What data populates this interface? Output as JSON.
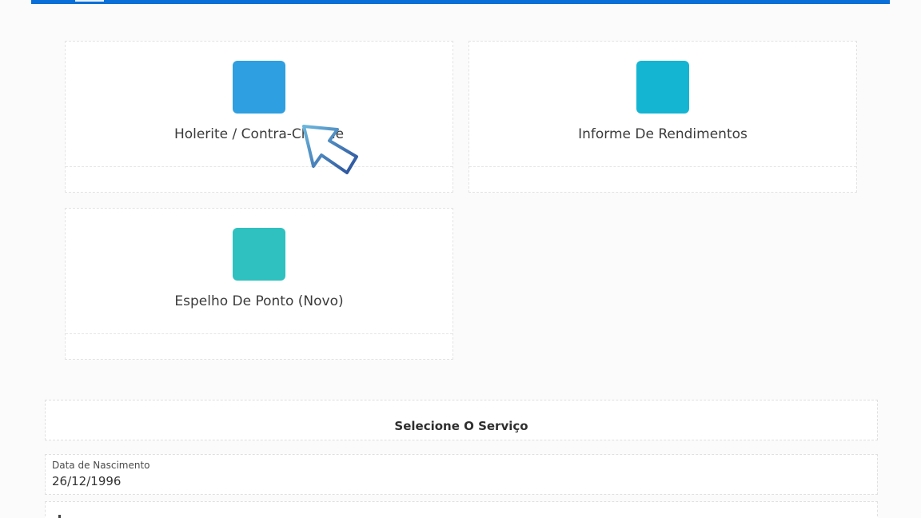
{
  "colors": {
    "top_bar": "#0a6fd6",
    "card_1_icon": "#2e9fe0",
    "card_2_icon": "#14b5d2",
    "card_3_icon": "#2ec1c0"
  },
  "cards": [
    {
      "title": "Holerite / Contra-Cheque",
      "icon": "document-icon"
    },
    {
      "title": "Informe De Rendimentos",
      "icon": "report-icon"
    },
    {
      "title": "Espelho De Ponto (Novo)",
      "icon": "clock-icon"
    }
  ],
  "service": {
    "title": "Selecione O Serviço"
  },
  "birth_date": {
    "label": "Data de Nascimento",
    "value": "26/12/1996"
  }
}
